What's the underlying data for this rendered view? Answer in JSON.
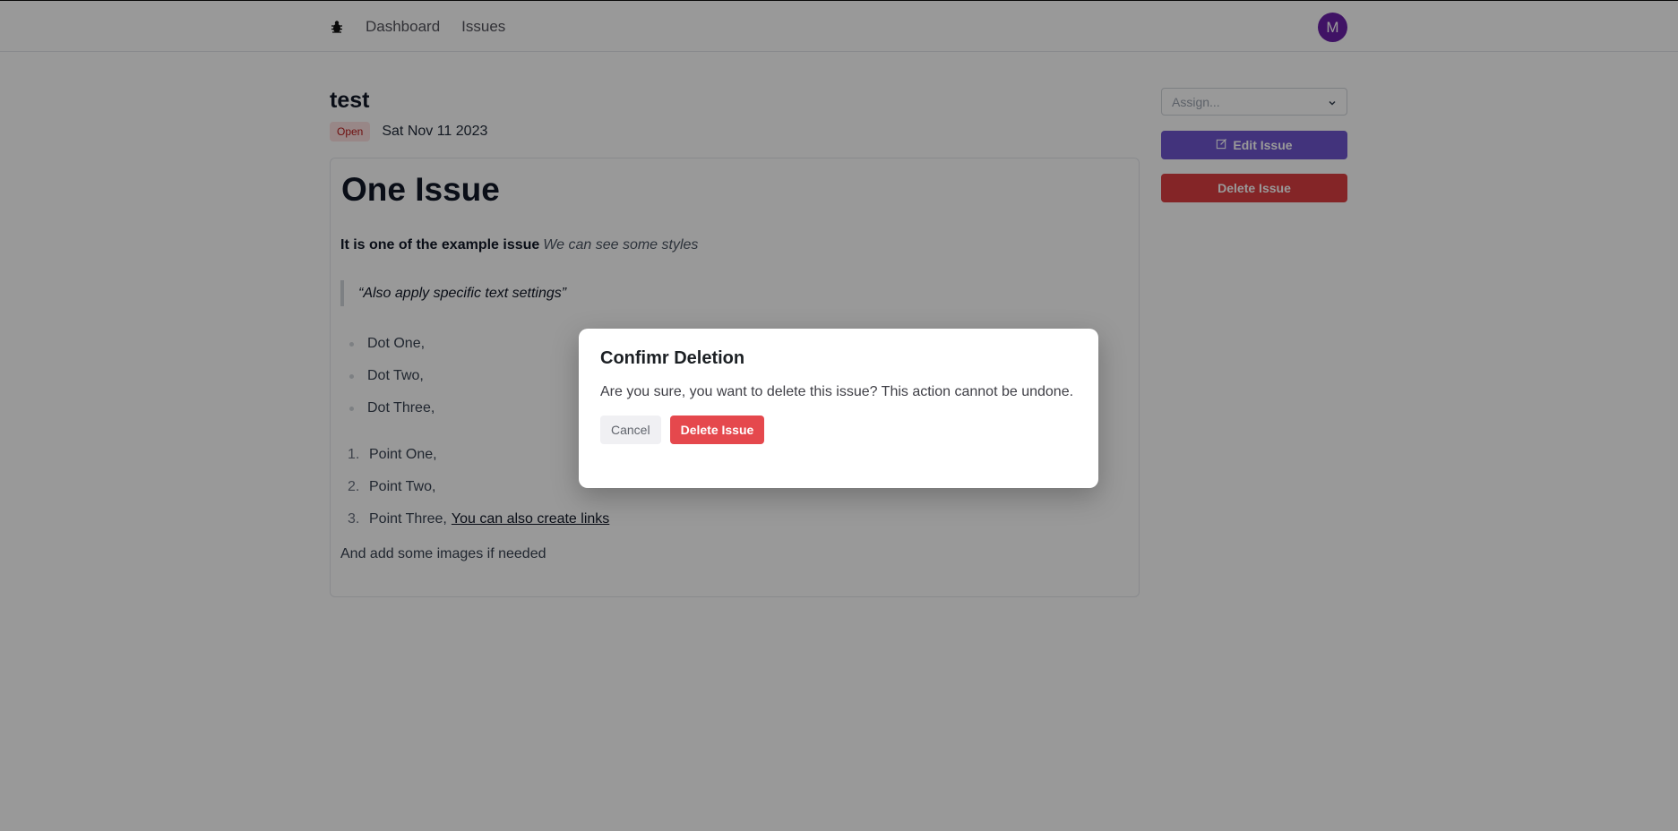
{
  "navbar": {
    "logo_icon": "bug-icon",
    "links": [
      "Dashboard",
      "Issues"
    ],
    "avatar_initial": "M"
  },
  "issue": {
    "title": "test",
    "status": "Open",
    "date": "Sat Nov 11 2023",
    "body": {
      "heading": "One Issue",
      "bold_text": "It is one of the example issue",
      "italic_text": "We can see some styles",
      "quote": "“Also apply specific text settings”",
      "bullets": [
        "Dot One,",
        "Dot Two,",
        "Dot Three,"
      ],
      "numbered": [
        {
          "num": "1.",
          "text": "Point One,"
        },
        {
          "num": "2.",
          "text": "Point Two,"
        },
        {
          "num": "3.",
          "text": "Point Three,",
          "link": "You can also create links"
        }
      ],
      "closing": "And add some images if needed"
    }
  },
  "sidebar": {
    "assign_placeholder": "Assign...",
    "edit_label": "Edit Issue",
    "delete_label": "Delete Issue"
  },
  "dialog": {
    "title": "Confimr Deletion",
    "description": "Are you sure, you want to delete this issue? This action cannot be undone.",
    "cancel_label": "Cancel",
    "confirm_label": "Delete Issue"
  },
  "colors": {
    "accent": "#6e56cf",
    "danger": "#dc3e42",
    "avatar": "#6b21a8"
  }
}
